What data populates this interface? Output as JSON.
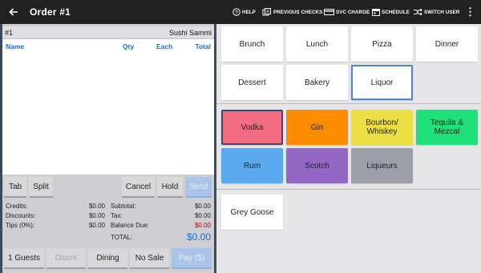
{
  "header": {
    "title": "Order #1",
    "actions": [
      {
        "label": "HELP",
        "icon": "help-icon"
      },
      {
        "label": "PREVIOUS CHECKS",
        "icon": "previous-checks-icon"
      },
      {
        "label": "SVC CHARGE",
        "icon": "service-charge-icon"
      },
      {
        "label": "SCHEDULE",
        "icon": "schedule-icon"
      },
      {
        "label": "SWITCH USER",
        "icon": "switch-user-icon"
      }
    ]
  },
  "order": {
    "number": "#1",
    "restaurant": "Sushi Sammi",
    "columns": {
      "name": "Name",
      "qty": "Qty",
      "each": "Each",
      "total": "Total"
    },
    "action_buttons": {
      "tab": "Tab",
      "split": "Split",
      "cancel": "Cancel",
      "hold": "Hold",
      "send": "Send"
    },
    "totals": {
      "credits_label": "Credits:",
      "credits": "$0.00",
      "discounts_label": "Discounts:",
      "discounts": "$0.00",
      "tips_label": "Tips (0%):",
      "tips": "$0.00",
      "subtotal_label": "Subtotal:",
      "subtotal": "$0.00",
      "tax_label": "Tax:",
      "tax": "$0.00",
      "balance_label": "Balance Due:",
      "balance": "$0.00",
      "total_label": "TOTAL:",
      "total": "$0.00"
    },
    "bottom_buttons": {
      "guests": "1 Guests",
      "discount": "Discnt",
      "dining": "Dining",
      "no_sale": "No Sale",
      "pay": "Pay ($)"
    }
  },
  "menus": [
    {
      "label": "Brunch"
    },
    {
      "label": "Lunch"
    },
    {
      "label": "Pizza"
    },
    {
      "label": "Dinner"
    },
    {
      "label": "Dessert"
    },
    {
      "label": "Bakery"
    },
    {
      "label": "Liquor",
      "selected": true
    }
  ],
  "categories": [
    {
      "label": "Vodka",
      "color": "#f26d81",
      "selected": true
    },
    {
      "label": "Gin",
      "color": "#fb8c00"
    },
    {
      "label": "Bourbon/\nWhiskey",
      "color": "#ecdf44"
    },
    {
      "label": "Tequila &\nMezcal",
      "color": "#1fe079"
    },
    {
      "label": "Rum",
      "color": "#5aa9ee"
    },
    {
      "label": "Scotch",
      "color": "#9467c6"
    },
    {
      "label": "Liqueurs",
      "color": "#9d9fa8"
    }
  ],
  "products": [
    {
      "label": "Grey Goose"
    }
  ]
}
